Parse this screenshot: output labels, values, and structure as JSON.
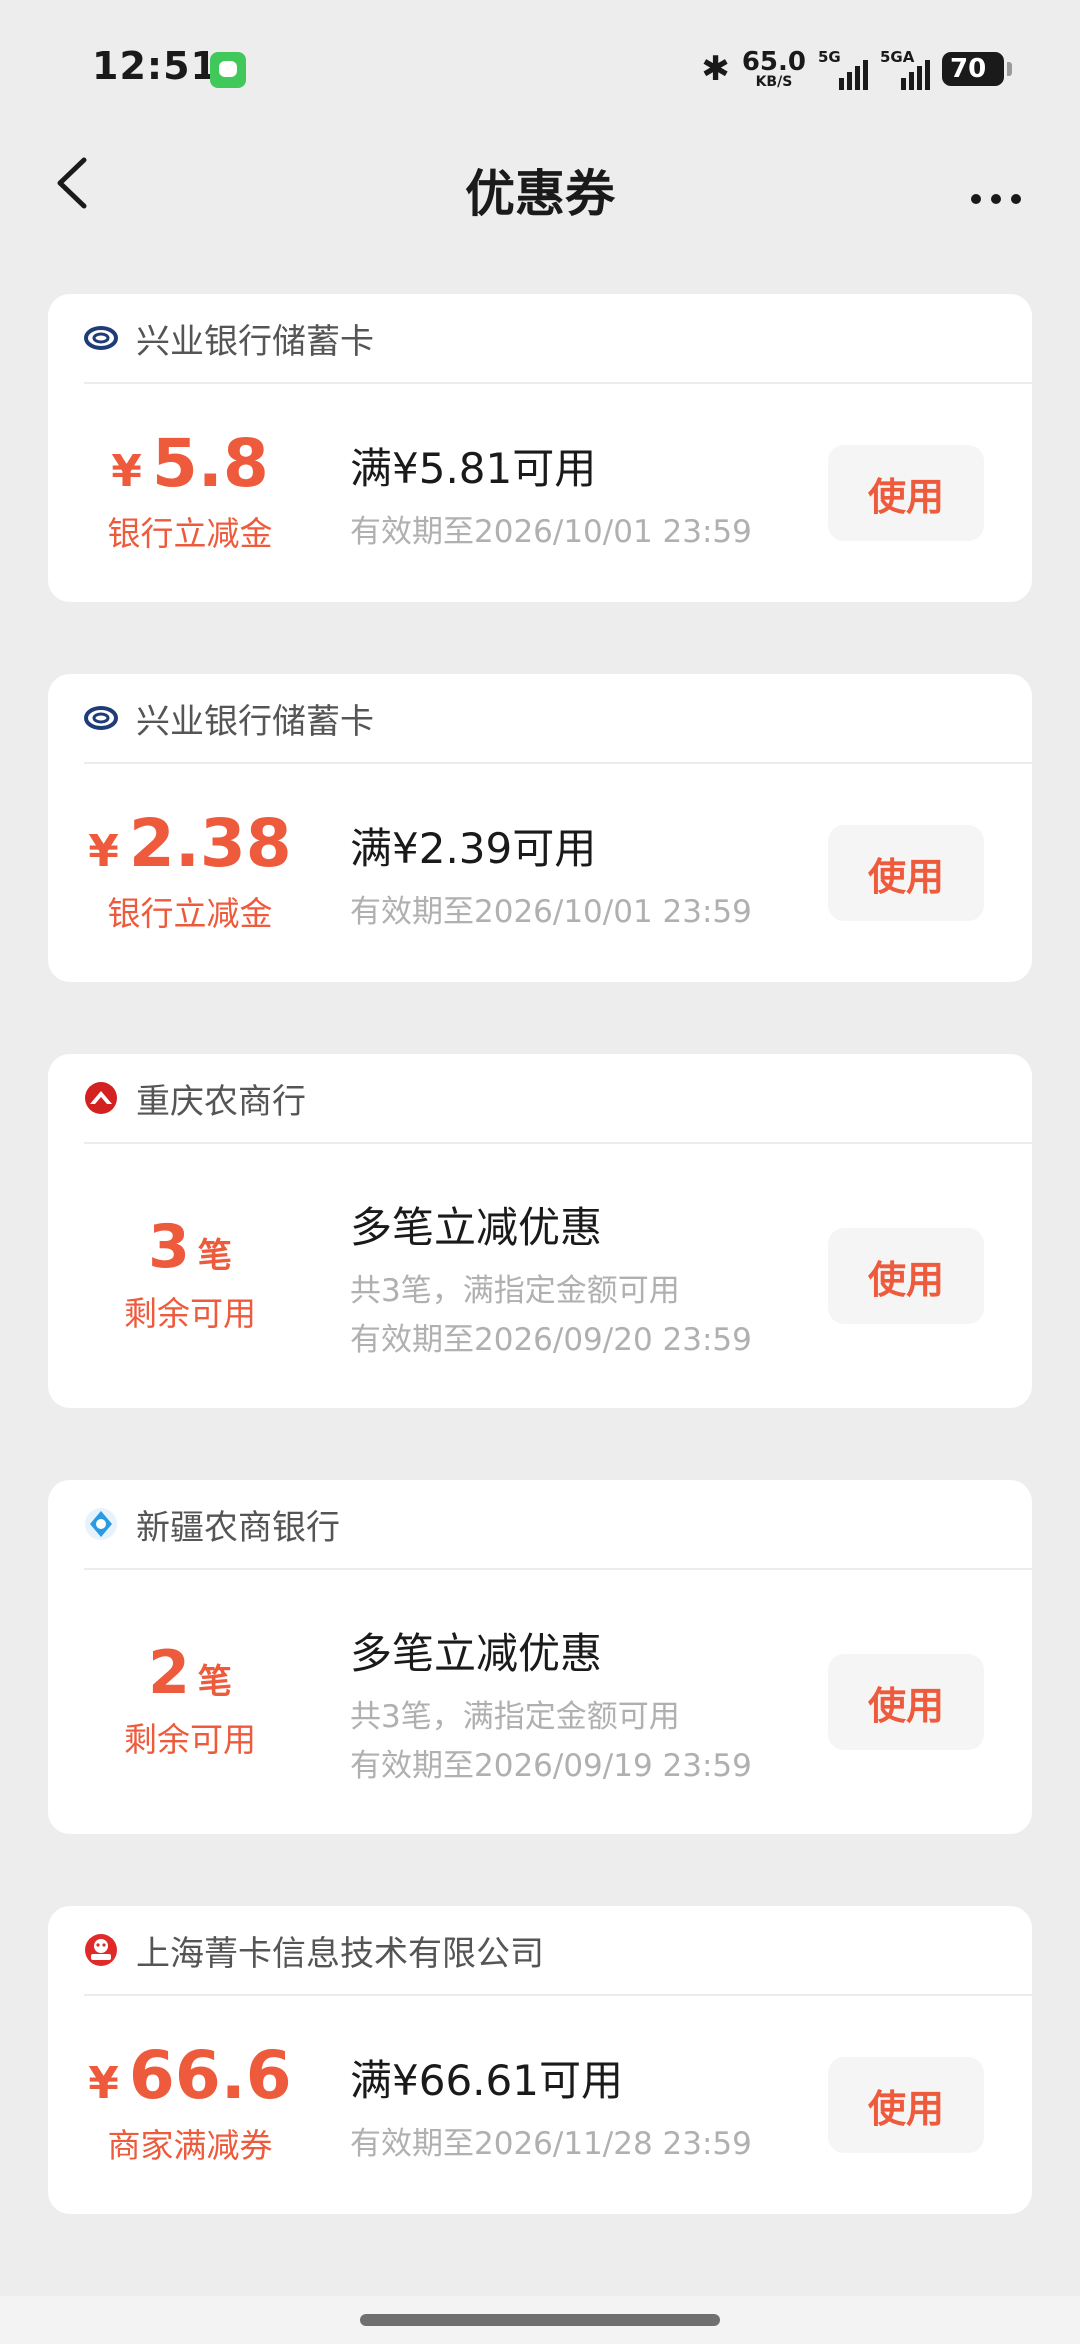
{
  "status_bar": {
    "time": "12:51",
    "net_speed_value": "65.0",
    "net_speed_unit": "KB/S",
    "signal_1_label": "5G",
    "signal_2_label": "5GA",
    "battery_level": "70"
  },
  "nav": {
    "title": "优惠券"
  },
  "coupons": [
    {
      "bank": "兴业银行储蓄卡",
      "yen": "¥",
      "amount": "5.8",
      "amount_sub": "银行立减金",
      "title": "满¥5.81可用",
      "desc": "有效期至2026/10/01 23:59",
      "button": "使用"
    },
    {
      "bank": "兴业银行储蓄卡",
      "yen": "¥",
      "amount": "2.38",
      "amount_sub": "银行立减金",
      "title": "满¥2.39可用",
      "desc": "有效期至2026/10/01 23:59",
      "button": "使用"
    },
    {
      "bank": "重庆农商行",
      "count": "3",
      "count_unit": "笔",
      "amount_sub": "剩余可用",
      "title": "多笔立减优惠",
      "desc1": "共3笔，满指定金额可用",
      "desc": "有效期至2026/09/20 23:59",
      "button": "使用"
    },
    {
      "bank": "新疆农商银行",
      "count": "2",
      "count_unit": "笔",
      "amount_sub": "剩余可用",
      "title": "多笔立减优惠",
      "desc1": "共3笔，满指定金额可用",
      "desc": "有效期至2026/09/19 23:59",
      "button": "使用"
    },
    {
      "bank": "上海菁卡信息技术有限公司",
      "yen": "¥",
      "amount": "66.6",
      "amount_sub": "商家满减券",
      "title": "满¥66.61可用",
      "desc": "有效期至2026/11/28 23:59",
      "button": "使用"
    }
  ],
  "icons": {
    "bank_icon_1": "cib-bank-icon",
    "bank_icon_2": "cqrcb-bank-icon",
    "bank_icon_3": "xjrcb-bank-icon",
    "bank_icon_4": "merchant-logo-icon"
  },
  "colors": {
    "accent": "#ee5a3c",
    "background": "#ededed",
    "card": "#ffffff"
  }
}
